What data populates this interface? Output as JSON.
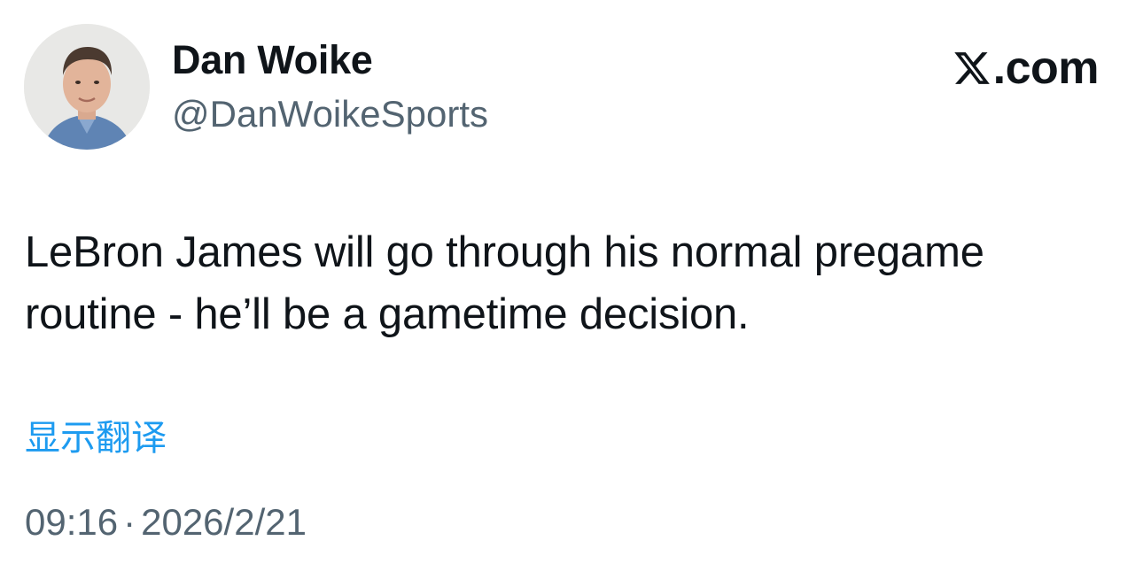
{
  "author": {
    "display_name": "Dan Woike",
    "handle": "@DanWoikeSports"
  },
  "brand": {
    "logo_icon": "x-logo-icon",
    "suffix": ".com"
  },
  "tweet": {
    "text": "LeBron James will go through his normal pregame routine - he’ll be a gametime decision.",
    "translate_label": "显示翻译",
    "time": "09:16",
    "separator": "·",
    "date": "2026/2/21"
  },
  "colors": {
    "link": "#1d9bf0",
    "secondary": "#536471",
    "primary_text": "#0f1419"
  }
}
